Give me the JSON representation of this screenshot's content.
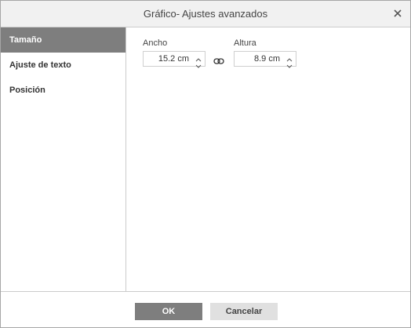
{
  "dialog": {
    "title": "Gráfico- Ajustes avanzados"
  },
  "sidebar": {
    "items": [
      {
        "label": "Tamaño",
        "active": true
      },
      {
        "label": "Ajuste de texto",
        "active": false
      },
      {
        "label": "Posición",
        "active": false
      }
    ]
  },
  "size": {
    "width_label": "Ancho",
    "width_value": "15.2 cm",
    "height_label": "Altura",
    "height_value": "8.9 cm",
    "constrain_icon": "link-icon"
  },
  "footer": {
    "ok_label": "OK",
    "cancel_label": "Cancelar"
  },
  "colors": {
    "active_item_bg": "#7e7e7e",
    "ok_button_bg": "#7e7e7e",
    "cancel_button_bg": "#e0e0e0",
    "titlebar_bg": "#f1f1f1"
  }
}
